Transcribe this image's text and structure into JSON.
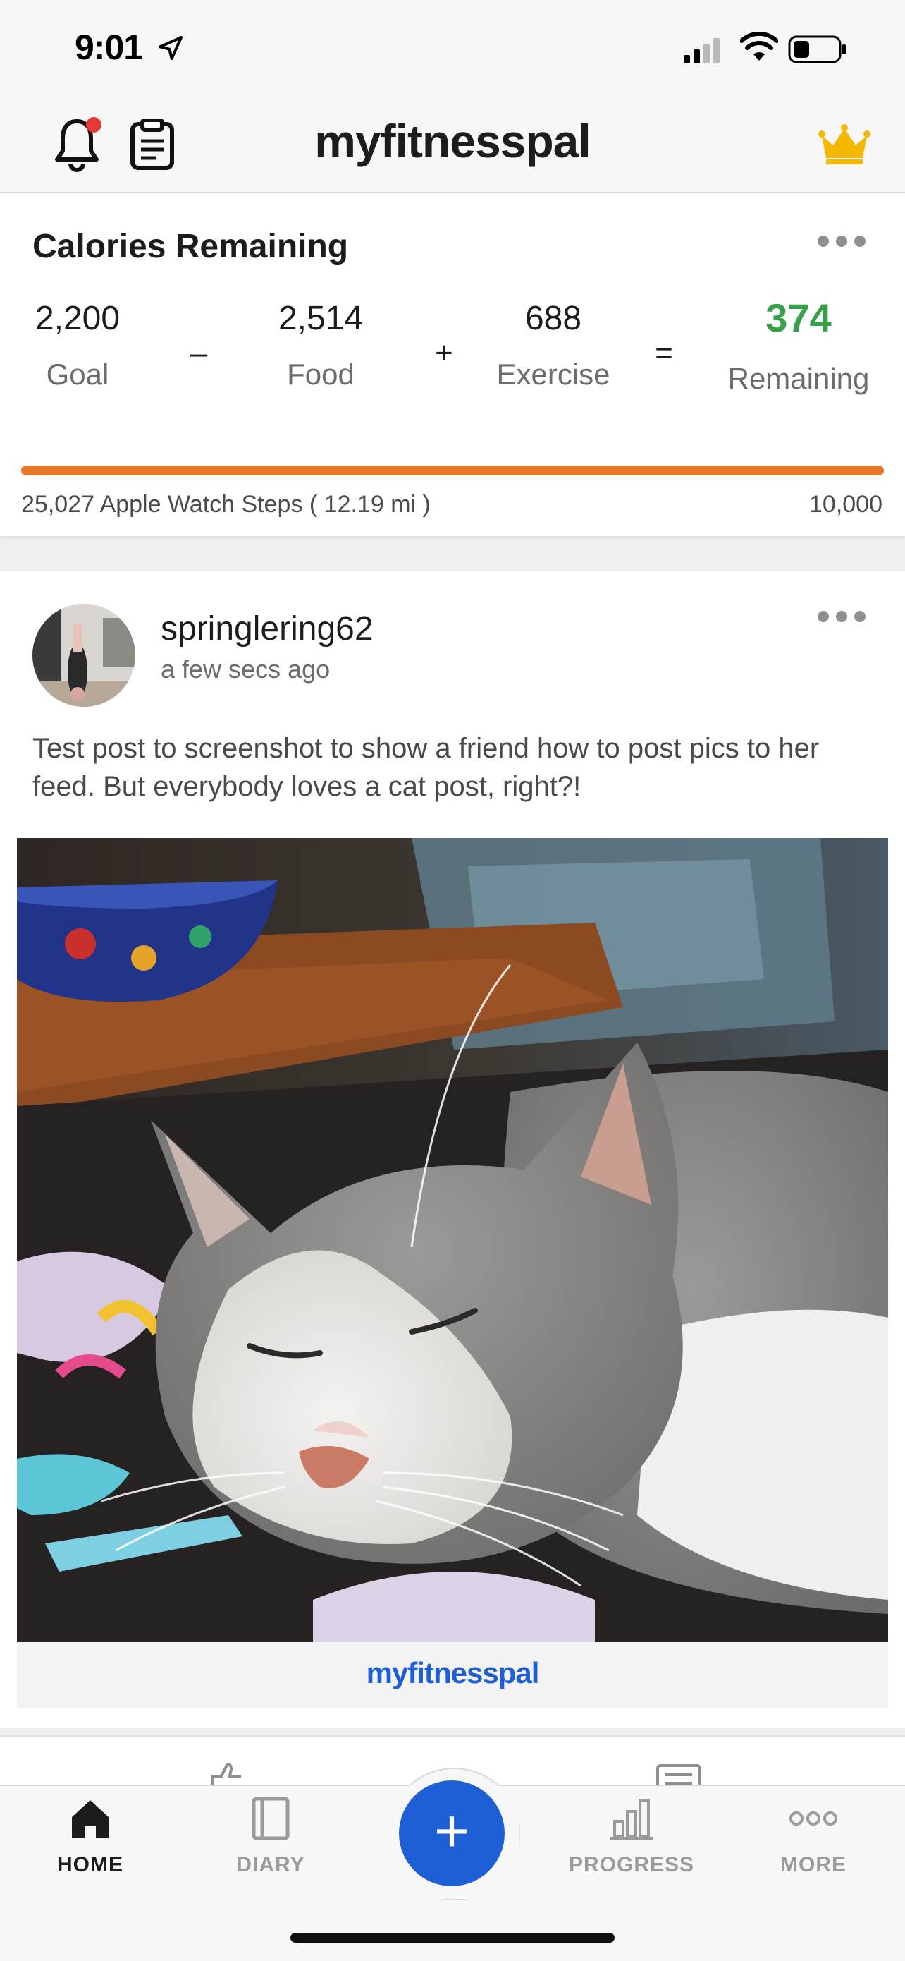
{
  "status_bar": {
    "time": "9:01"
  },
  "header": {
    "brand": "myfitnesspal"
  },
  "calories": {
    "title": "Calories Remaining",
    "goal": {
      "value": "2,200",
      "label": "Goal"
    },
    "minus": "–",
    "food": {
      "value": "2,514",
      "label": "Food"
    },
    "plus": "+",
    "exercise": {
      "value": "688",
      "label": "Exercise"
    },
    "equals": "=",
    "remaining": {
      "value": "374",
      "label": "Remaining"
    },
    "steps_text": "25,027 Apple Watch Steps  ( 12.19 mi )",
    "steps_goal": "10,000",
    "steps_progress": 1.0
  },
  "post": {
    "username": "springlering62",
    "time_ago": "a few secs ago",
    "text": "Test post to screenshot to show a friend how to post pics to her feed.  But everybody loves a cat post, right?!",
    "image_footer": "myfitnesspal"
  },
  "tabbar": {
    "home": "HOME",
    "diary": "DIARY",
    "add": "+",
    "progress": "PROGRESS",
    "more": "MORE"
  },
  "colors": {
    "accent_blue": "#1f5fd6",
    "progress_orange": "#e8772a",
    "remaining_green": "#36a04a",
    "notification_red": "#e53935",
    "crown_gold": "#f5b800"
  }
}
